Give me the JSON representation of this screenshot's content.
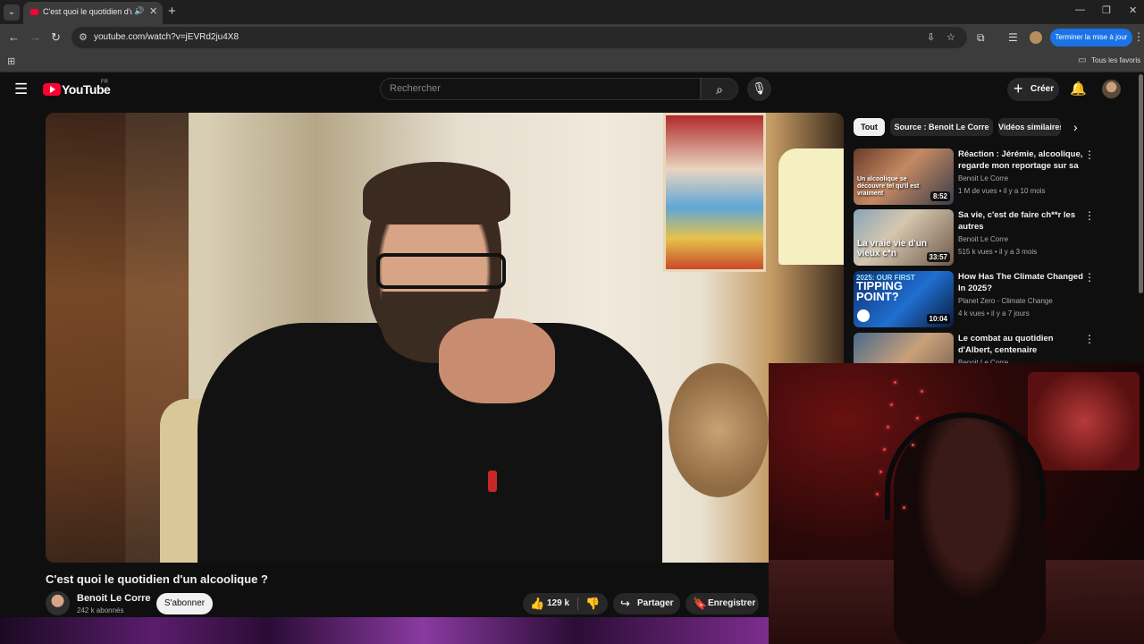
{
  "browser": {
    "tab_title": "C'est quoi le quotidien d'un alcoolique ?",
    "url": "youtube.com/watch?v=jEVRd2ju4X8",
    "update_button": "Terminer la mise à jour",
    "bookmarks_all": "Tous les favoris"
  },
  "youtube": {
    "wordmark": "YouTube",
    "country_code": "FR",
    "search_placeholder": "Rechercher",
    "create_label": "Créer"
  },
  "video": {
    "title": "C'est quoi le quotidien d'un alcoolique ?",
    "channel_name": "Benoit Le Corre",
    "subscribers": "242 k abonnés",
    "subscribe_label": "S'abonner",
    "likes": "129 k",
    "share_label": "Partager",
    "save_label": "Enregistrer"
  },
  "chips": [
    "Tout",
    "Source : Benoit Le Corre",
    "Vidéos similaires"
  ],
  "recommendations": [
    {
      "title": "Réaction : Jérémie, alcoolique, regarde mon reportage sur sa ...",
      "channel": "Benoit Le Corre",
      "meta": "1 M de vues • il y a 10 mois",
      "duration": "8:52",
      "thumb_text": "Un alcoolique se découvre tel qu'il est vraiment"
    },
    {
      "title": "Sa vie, c'est de faire ch**r les autres",
      "channel": "Benoit Le Corre",
      "meta": "515 k vues • il y a 3 mois",
      "duration": "33:57",
      "thumb_text": "La vraie vie d'un vieux c*n"
    },
    {
      "title": "How Has The Climate Changed In 2025?",
      "channel": "Planet Zero - Climate Change",
      "meta": "4 k vues • il y a 7 jours",
      "duration": "10:04",
      "thumb_small": "2025: OUR FIRST",
      "thumb_big": "TIPPING POINT?"
    },
    {
      "title": "Le combat au quotidien d'Albert, centenaire",
      "channel": "Benoit Le Corre",
      "meta": "",
      "duration": ""
    }
  ],
  "colors": {
    "brand_red": "#ff0033",
    "update_blue": "#1a73e8",
    "background": "#0f0f0f"
  }
}
